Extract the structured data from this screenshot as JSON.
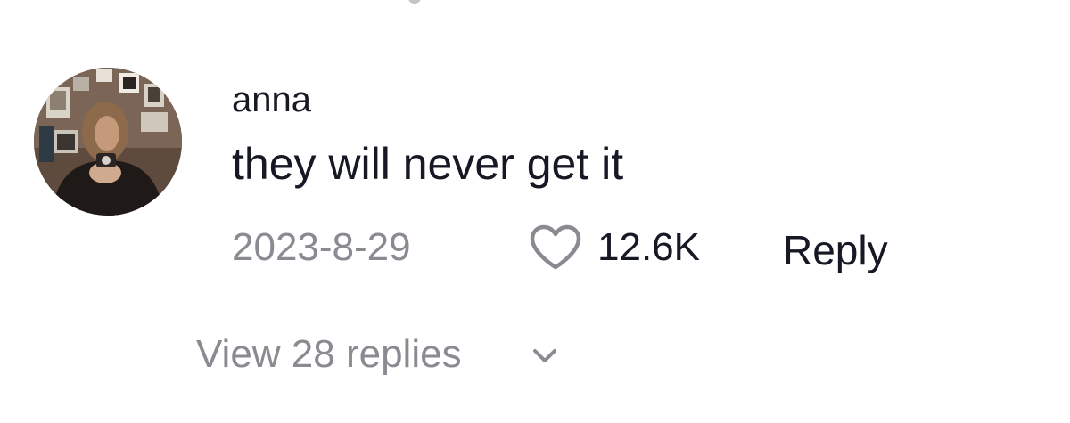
{
  "comment": {
    "username": "anna",
    "text": "they will never get it",
    "date": "2023-8-29",
    "like_count": "12.6K",
    "reply_label": "Reply",
    "view_replies_label": "View 28 replies",
    "avatar_icon": "user-avatar-photo",
    "like_icon": "heart-outline-icon",
    "expand_icon": "chevron-down-icon"
  },
  "colors": {
    "primary_text": "#161823",
    "secondary_text": "#8a8b91",
    "icon_stroke": "#8a8b91",
    "background": "#ffffff"
  }
}
